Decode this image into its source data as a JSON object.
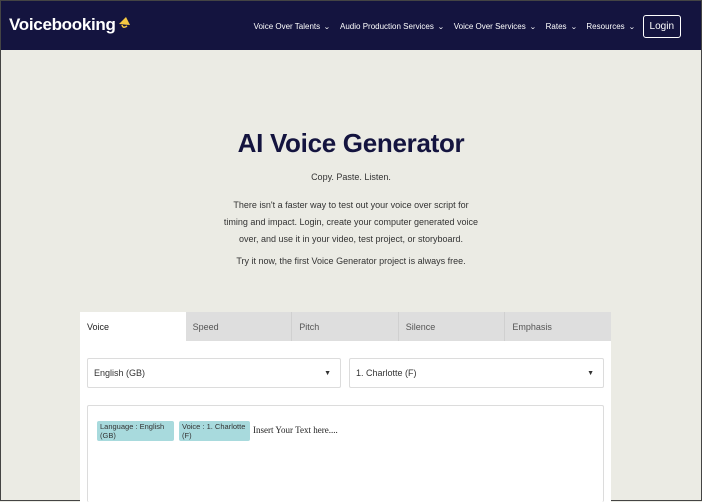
{
  "nav": {
    "logo_text": "Voicebooking",
    "menu": [
      {
        "label": "Voice Over Talents"
      },
      {
        "label": "Audio Production Services"
      },
      {
        "label": "Voice Over Services"
      },
      {
        "label": "Rates"
      },
      {
        "label": "Resources"
      }
    ],
    "login_label": "Login",
    "bg_color": "#14143f",
    "accent_color": "#f5c842"
  },
  "hero": {
    "title": "AI Voice Generator",
    "tagline": "Copy. Paste. Listen.",
    "description": "There isn't a faster way to test out your voice over script for timing and impact. Login, create your computer generated voice over, and use it in your video, test project, or storyboard.",
    "free_note": "Try it now, the first Voice Generator project is always free."
  },
  "generator": {
    "tabs": [
      {
        "label": "Voice",
        "active": true
      },
      {
        "label": "Speed"
      },
      {
        "label": "Pitch"
      },
      {
        "label": "Silence"
      },
      {
        "label": "Emphasis"
      }
    ],
    "language_select": "English (GB)",
    "voice_select": "1. Charlotte (F)",
    "tags": {
      "language": "Language : English (GB)",
      "voice": "Voice : 1. Charlotte (F)"
    },
    "placeholder": "Insert Your Text here....",
    "tag_color": "#a8dadd"
  }
}
